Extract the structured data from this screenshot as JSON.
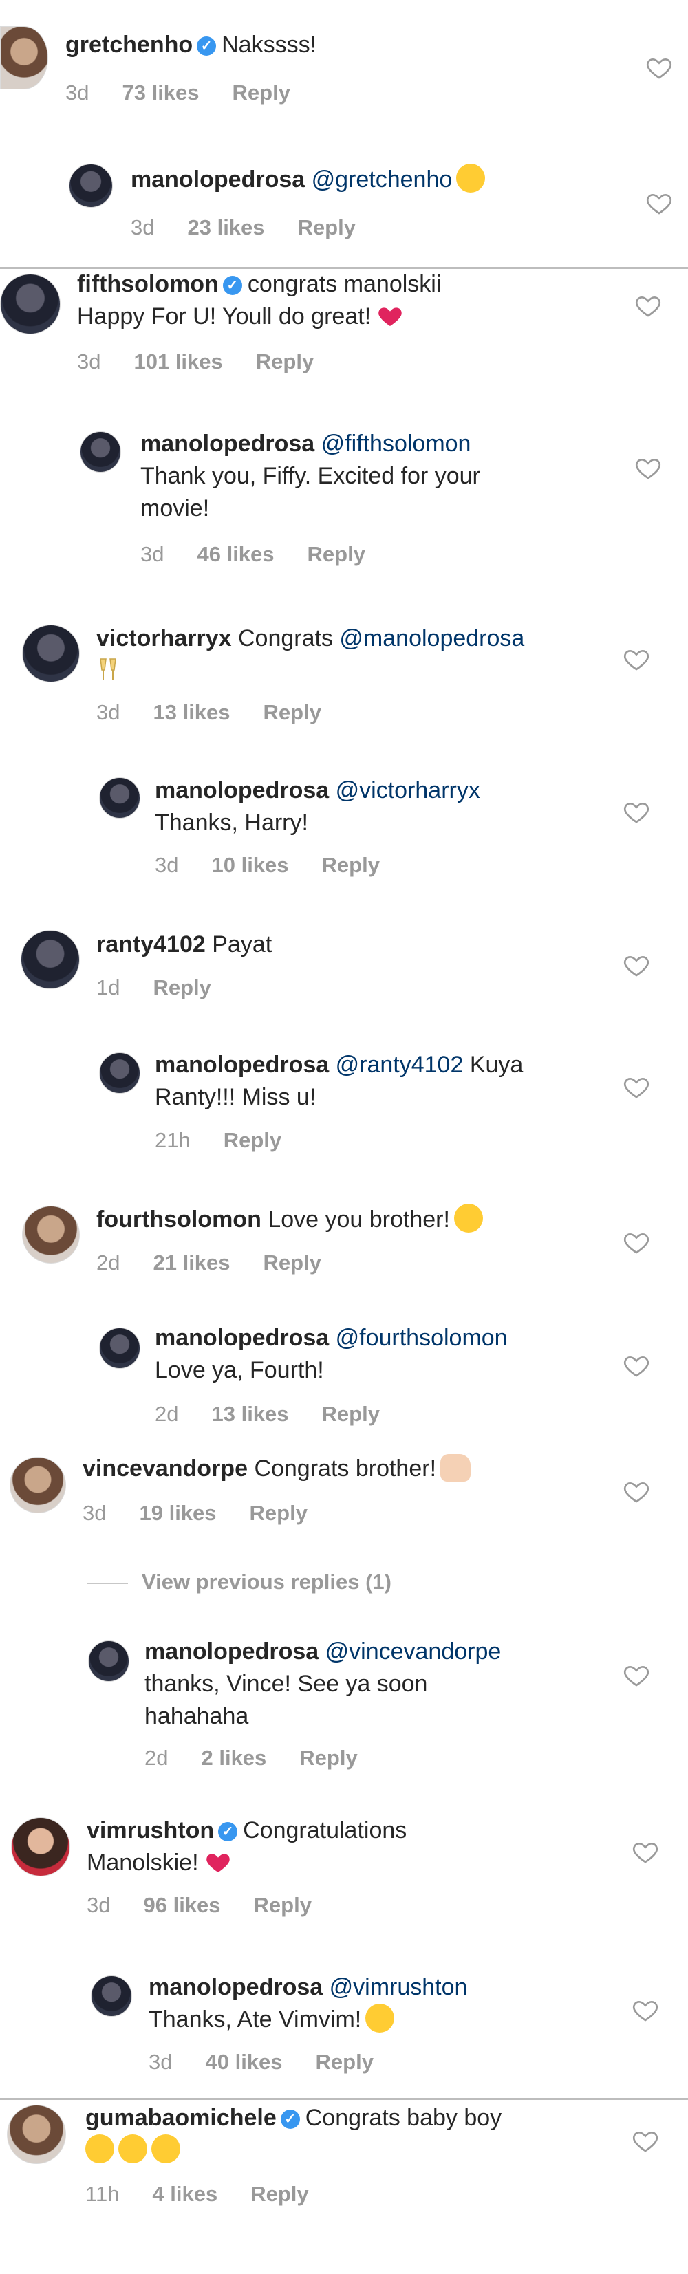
{
  "comments": [
    {
      "user": "gretchenho",
      "verified": true,
      "text": "Nakssss!",
      "time": "3d",
      "likes": "73 likes",
      "reply": "Reply"
    },
    {
      "user": "manolopedrosa",
      "mention": "@gretchenho",
      "text": "",
      "time": "3d",
      "likes": "23 likes",
      "reply": "Reply"
    },
    {
      "user": "fifthsolomon",
      "verified": true,
      "text_line1": "congrats manolskii",
      "text_line2": "Happy For U! Youll do great!",
      "time": "3d",
      "likes": "101 likes",
      "reply": "Reply"
    },
    {
      "user": "manolopedrosa",
      "mention": "@fifthsolomon",
      "text_line2": "Thank you, Fiffy. Excited for your",
      "text_line3": "movie!",
      "time": "3d",
      "likes": "46 likes",
      "reply": "Reply"
    },
    {
      "user": "victorharryx",
      "text": "Congrats",
      "mention": "@manolopedrosa",
      "time": "3d",
      "likes": "13 likes",
      "reply": "Reply"
    },
    {
      "user": "manolopedrosa",
      "mention": "@victorharryx",
      "text_line2": "Thanks, Harry!",
      "time": "3d",
      "likes": "10 likes",
      "reply": "Reply"
    },
    {
      "user": "ranty4102",
      "text": "Payat",
      "time": "1d",
      "reply": "Reply"
    },
    {
      "user": "manolopedrosa",
      "mention": "@ranty4102",
      "text": "Kuya",
      "text_line2": "Ranty!!! Miss u!",
      "time": "21h",
      "reply": "Reply"
    },
    {
      "user": "fourthsolomon",
      "text": "Love you brother!",
      "time": "2d",
      "likes": "21 likes",
      "reply": "Reply"
    },
    {
      "user": "manolopedrosa",
      "mention": "@fourthsolomon",
      "text_line2": "Love ya, Fourth!",
      "time": "2d",
      "likes": "13 likes",
      "reply": "Reply"
    },
    {
      "user": "vincevandorpe",
      "text": "Congrats brother!",
      "time": "3d",
      "likes": "19 likes",
      "reply": "Reply"
    },
    {
      "user": "manolopedrosa",
      "mention": "@vincevandorpe",
      "text_line2": "thanks, Vince! See ya soon",
      "text_line3": "hahahaha",
      "time": "2d",
      "likes": "2 likes",
      "reply": "Reply"
    },
    {
      "user": "vimrushton",
      "verified": true,
      "text_line1": "Congratulations",
      "text_line2": "Manolskie!",
      "time": "3d",
      "likes": "96 likes",
      "reply": "Reply"
    },
    {
      "user": "manolopedrosa",
      "mention": "@vimrushton",
      "text_line2": "Thanks, Ate Vimvim!",
      "time": "3d",
      "likes": "40 likes",
      "reply": "Reply"
    },
    {
      "user": "gumabaomichele",
      "verified": true,
      "text_line1": "Congrats baby boy",
      "time": "11h",
      "likes": "4 likes",
      "reply": "Reply"
    }
  ],
  "view_previous": "View previous replies (1)",
  "icons": {
    "like": "heart-outline-icon",
    "verified": "verified-badge-icon"
  },
  "colors": {
    "mention": "#003569",
    "meta": "#999999",
    "verified": "#3897f0",
    "heart": "#ed4956"
  }
}
